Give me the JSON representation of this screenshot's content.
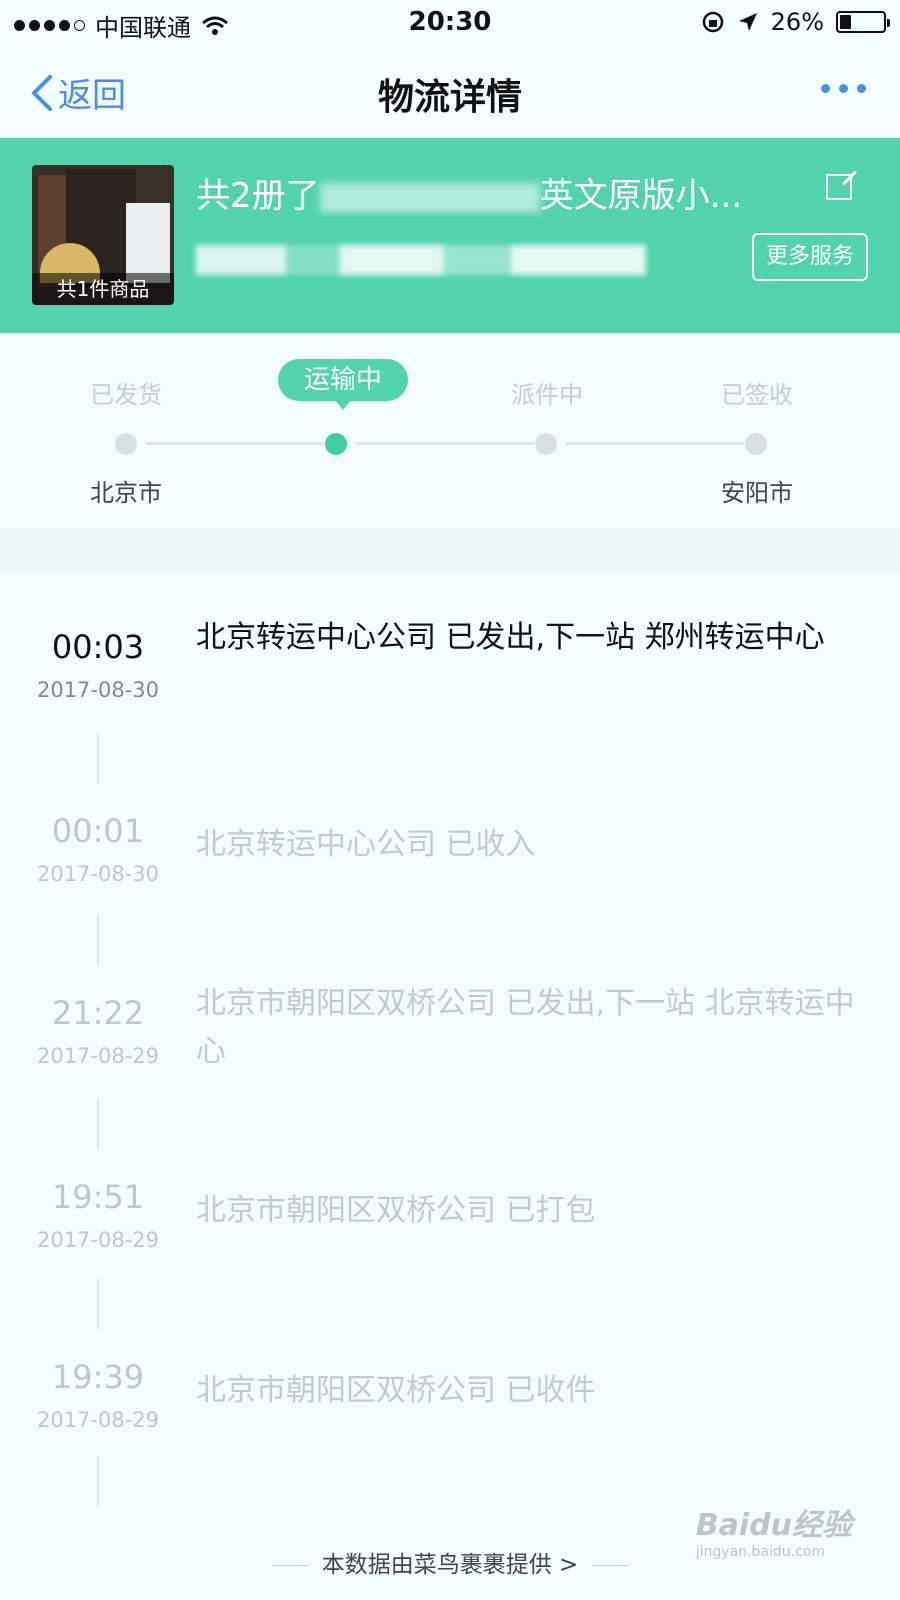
{
  "status_bar": {
    "carrier": "中国联通",
    "time": "20:30",
    "battery": "26%",
    "battery_level": 0.26
  },
  "nav": {
    "back_label": "返回",
    "title": "物流详情"
  },
  "product": {
    "title": "共2册了",
    "title_tail": "英文原版小...",
    "item_count": "共1件商品",
    "more_service": "更多服务"
  },
  "progress": {
    "steps": [
      "已发货",
      "运输中",
      "派件中",
      "已签收"
    ],
    "current_step": 1,
    "origin_city": "北京市",
    "destination_city": "安阳市"
  },
  "events": [
    {
      "time": "00:03",
      "date": "2017-08-30",
      "text": "北京转运中心公司 已发出,下一站 郑州转运中心"
    },
    {
      "time": "00:01",
      "date": "2017-08-30",
      "text": "北京转运中心公司 已收入"
    },
    {
      "time": "21:22",
      "date": "2017-08-29",
      "text": "北京市朝阳区双桥公司 已发出,下一站 北京转运中心"
    },
    {
      "time": "19:51",
      "date": "2017-08-29",
      "text": "北京市朝阳区双桥公司 已打包"
    },
    {
      "time": "19:39",
      "date": "2017-08-29",
      "text": "北京市朝阳区双桥公司 已收件"
    }
  ],
  "footer": {
    "source_text": "本数据由菜鸟裹裹提供 >"
  },
  "watermark": {
    "brand": "Baidu经验",
    "url": "jingyan.baidu.com"
  },
  "colors": {
    "accent": "#52d3ad",
    "link": "#4a90e2"
  }
}
